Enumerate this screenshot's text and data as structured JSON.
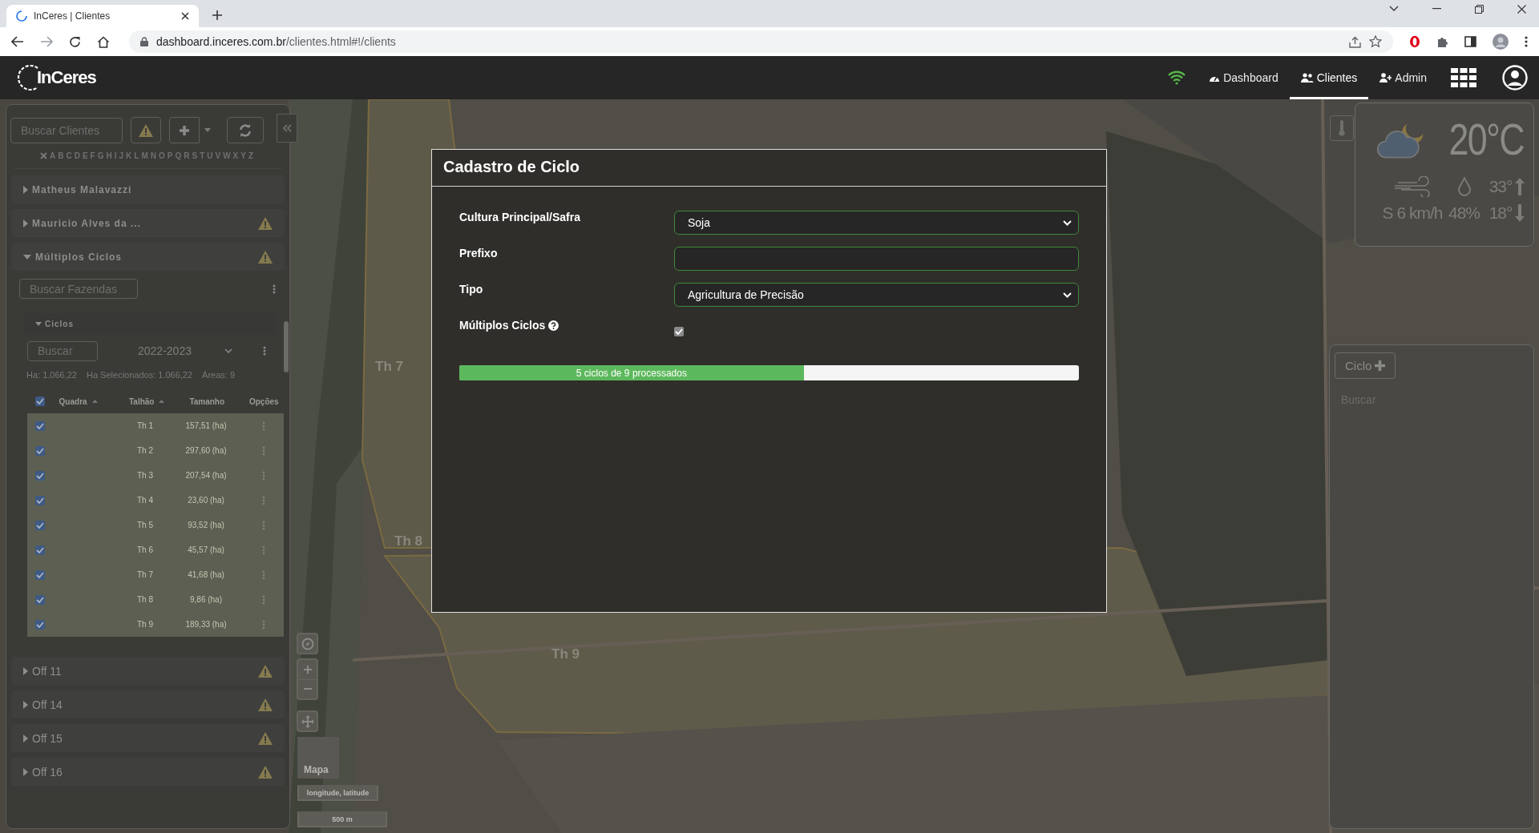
{
  "browser": {
    "tab_title": "InCeres | Clientes",
    "url_host": "dashboard.inceres.com.br",
    "url_path": "/clientes.html#!/clients"
  },
  "header": {
    "logo": "InCeres",
    "nav": [
      {
        "label": "Dashboard",
        "selected": false
      },
      {
        "label": "Clientes",
        "selected": true
      },
      {
        "label": "Admin",
        "selected": false
      }
    ]
  },
  "sidebar": {
    "search_placeholder": "Buscar Clientes",
    "alphabet": [
      "A",
      "B",
      "C",
      "D",
      "E",
      "F",
      "G",
      "H",
      "I",
      "J",
      "K",
      "L",
      "M",
      "N",
      "O",
      "P",
      "Q",
      "R",
      "S",
      "T",
      "U",
      "V",
      "W",
      "X",
      "Y",
      "Z"
    ],
    "clients": [
      {
        "name": "Matheus Malavazzi",
        "expanded": false,
        "warning": false
      },
      {
        "name": "Mauricio Alves da ...",
        "expanded": false,
        "warning": true
      },
      {
        "name": "Múltiplos Ciclos",
        "expanded": true,
        "warning": true,
        "farm_search_placeholder": "Buscar Fazendas",
        "cycles": {
          "title": "Ciclos",
          "expanded": true,
          "search_placeholder": "Buscar",
          "season": "2022-2023",
          "stats": [
            "Ha: 1.066,22",
            "Ha Selecionados: 1.066,22",
            "Áreas: 9"
          ],
          "all_checked": true,
          "columns": [
            {
              "label": "Quadra",
              "sortable": true
            },
            {
              "label": "Talhão",
              "sortable": true
            },
            {
              "label": "Tamanho",
              "sortable": false
            },
            {
              "label": "Opções",
              "sortable": false
            }
          ],
          "rows": [
            {
              "checked": true,
              "talhao": "Th 1",
              "tamanho": "157,51 (ha)"
            },
            {
              "checked": true,
              "talhao": "Th 2",
              "tamanho": "297,60 (ha)"
            },
            {
              "checked": true,
              "talhao": "Th 3",
              "tamanho": "207,54 (ha)"
            },
            {
              "checked": true,
              "talhao": "Th 4",
              "tamanho": "23,60 (ha)"
            },
            {
              "checked": true,
              "talhao": "Th 5",
              "tamanho": "93,52 (ha)"
            },
            {
              "checked": true,
              "talhao": "Th 6",
              "tamanho": "45,57 (ha)"
            },
            {
              "checked": true,
              "talhao": "Th 7",
              "tamanho": "41,68 (ha)"
            },
            {
              "checked": true,
              "talhao": "Th 8",
              "tamanho": "9,86 (ha)"
            },
            {
              "checked": true,
              "talhao": "Th 9",
              "tamanho": "189,33 (ha)"
            }
          ]
        }
      },
      {
        "name": "Off 11",
        "expanded": false,
        "warning": true
      },
      {
        "name": "Off 14",
        "expanded": false,
        "warning": true
      },
      {
        "name": "Off 15",
        "expanded": false,
        "warning": true
      },
      {
        "name": "Off 16",
        "expanded": false,
        "warning": true
      }
    ]
  },
  "map": {
    "field_labels": [
      "Th 7",
      "Th 8",
      "Th 9"
    ],
    "minimap_label": "Mapa",
    "coordinates": "longitude, latitude",
    "scale": "500 m"
  },
  "weather": {
    "temperature": "20°C",
    "wind": "S 6 km/h",
    "humidity": "48%",
    "max": "33°",
    "min": "18°"
  },
  "cycle_panel": {
    "button": "Ciclo",
    "search_placeholder": "Buscar"
  },
  "modal": {
    "title": "Cadastro de Ciclo",
    "fields": [
      {
        "kind": "select",
        "label": "Cultura Principal/Safra",
        "value": "Soja"
      },
      {
        "kind": "text",
        "label": "Prefixo"
      },
      {
        "kind": "select",
        "label": "Tipo",
        "value": "Agricultura de Precisão"
      },
      {
        "kind": "checkbox",
        "label": "Múltiplos Ciclos",
        "help": true,
        "checked": true,
        "disabled": true
      }
    ],
    "progress": {
      "text": "5 ciclos de 9 processados",
      "level": 0.556
    }
  }
}
